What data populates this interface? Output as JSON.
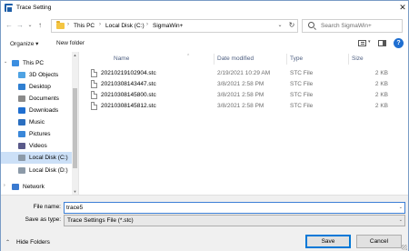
{
  "window": {
    "title": "Trace Setting",
    "close_glyph": "✕",
    "icon": "app-icon"
  },
  "nav_buttons": {
    "back": "←",
    "forward": "→",
    "dropdown": "⌄",
    "up": "↑"
  },
  "address_bar": {
    "crumbs": [
      "This PC",
      "Local Disk (C:)",
      "SigmaWin+"
    ],
    "separator": "›",
    "dropdown_glyph": "⌄",
    "refresh_glyph": "↻"
  },
  "search": {
    "placeholder": "Search SigmaWin+"
  },
  "toolbar": {
    "organize_label": "Organize ▾",
    "new_folder_label": "New folder",
    "help_glyph": "?"
  },
  "nav_pane": {
    "items": [
      {
        "label": "This PC",
        "icon": "computer-icon",
        "color": "#3b8ee0",
        "chevron": "⌄",
        "selected": false
      },
      {
        "label": "3D Objects",
        "icon": "cube-icon",
        "color": "#4fa3e3",
        "chevron": "",
        "selected": false
      },
      {
        "label": "Desktop",
        "icon": "desktop-icon",
        "color": "#2f7fd1",
        "chevron": "",
        "selected": false
      },
      {
        "label": "Documents",
        "icon": "documents-icon",
        "color": "#8a8a8a",
        "chevron": "",
        "selected": false
      },
      {
        "label": "Downloads",
        "icon": "download-icon",
        "color": "#1f6fd1",
        "chevron": "",
        "selected": false
      },
      {
        "label": "Music",
        "icon": "music-icon",
        "color": "#2b6fc0",
        "chevron": "",
        "selected": false
      },
      {
        "label": "Pictures",
        "icon": "pictures-icon",
        "color": "#3a87d9",
        "chevron": "",
        "selected": false
      },
      {
        "label": "Videos",
        "icon": "videos-icon",
        "color": "#5a5a8a",
        "chevron": "",
        "selected": false
      },
      {
        "label": "Local Disk (C:)",
        "icon": "drive-icon",
        "color": "#8c9aa8",
        "chevron": "",
        "selected": true
      },
      {
        "label": "Local Disk (D:)",
        "icon": "drive-icon",
        "color": "#8c9aa8",
        "chevron": "",
        "selected": false
      },
      {
        "label": "Network",
        "icon": "network-icon",
        "color": "#3a7ad0",
        "chevron": "›",
        "selected": false
      }
    ]
  },
  "file_list": {
    "columns": {
      "name": "Name",
      "date": "Date modified",
      "type": "Type",
      "size": "Size"
    },
    "sort_glyph": "⌃",
    "rows": [
      {
        "name": "20210219102904.stc",
        "date": "2/19/2021 10:29 AM",
        "type": "STC File",
        "size": "2 KB"
      },
      {
        "name": "20210308143447.stc",
        "date": "3/8/2021 2:58 PM",
        "type": "STC File",
        "size": "2 KB"
      },
      {
        "name": "20210308145800.stc",
        "date": "3/8/2021 2:58 PM",
        "type": "STC File",
        "size": "2 KB"
      },
      {
        "name": "20210308145812.stc",
        "date": "3/8/2021 2:58 PM",
        "type": "STC File",
        "size": "2 KB"
      }
    ]
  },
  "form": {
    "file_name_label": "File name:",
    "file_name_value": "trace5",
    "save_type_label": "Save as type:",
    "save_type_value": "Trace Settings File (*.stc)",
    "dropdown_glyph": "⌄"
  },
  "footer": {
    "hide_folders_label": "Hide Folders",
    "hide_folders_glyph": "⌃",
    "save_label": "Save",
    "cancel_label": "Cancel"
  },
  "colors": {
    "accent": "#0078d7",
    "selection": "#cce0f7"
  }
}
